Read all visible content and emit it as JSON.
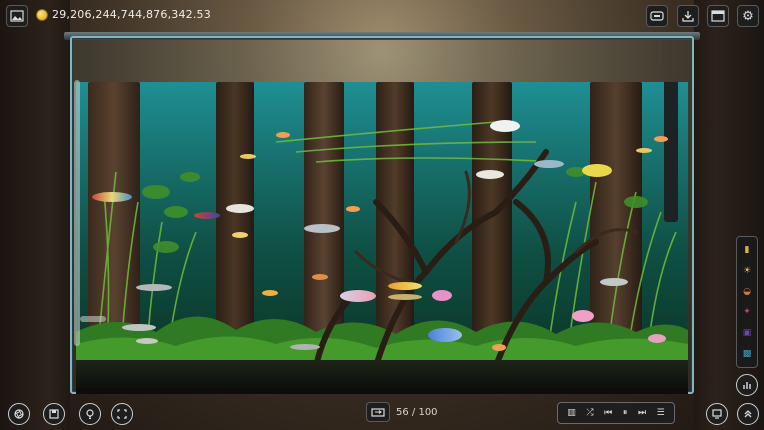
{
  "currency": {
    "amount": "29,206,244,744,876,342.53",
    "icon": "gold-coin-icon"
  },
  "top_left": {
    "icon": "gallery-icon"
  },
  "top_right": {
    "buttons": [
      {
        "name": "tank-shop-icon"
      },
      {
        "name": "download-icon"
      },
      {
        "name": "window-icon"
      },
      {
        "name": "gear-icon"
      }
    ]
  },
  "fish_counter": {
    "icon": "tank-swap-icon",
    "text": "56 / 100"
  },
  "media": {
    "buttons": [
      "equalizer-icon",
      "shuffle-icon",
      "previous-icon",
      "pause-icon",
      "next-icon",
      "playlist-icon"
    ]
  },
  "bottom_left": {
    "buttons": [
      "camera-shutter-icon",
      "save-icon",
      "light-bulb-icon",
      "fullscreen-icon"
    ]
  },
  "bottom_right": {
    "buttons": [
      "display-icon",
      "expand-up-icon"
    ]
  },
  "side_panel": {
    "items": [
      {
        "name": "time-day-icon",
        "color": "#d8b24a"
      },
      {
        "name": "sun-icon",
        "color": "#e8b83a"
      },
      {
        "name": "sunset-icon",
        "color": "#d07a3a"
      },
      {
        "name": "dusk-icon",
        "color": "#b04a6a"
      },
      {
        "name": "night-icon",
        "color": "#6a4ab0"
      },
      {
        "name": "moon-icon",
        "color": "#3aa0c8"
      }
    ],
    "stats_icon": "stats-icon"
  },
  "colors": {
    "water_top": "#1f8f94",
    "water_bottom": "#0b3526",
    "tank_frame": "#7fb6c0",
    "coin": "#d9a21e"
  }
}
